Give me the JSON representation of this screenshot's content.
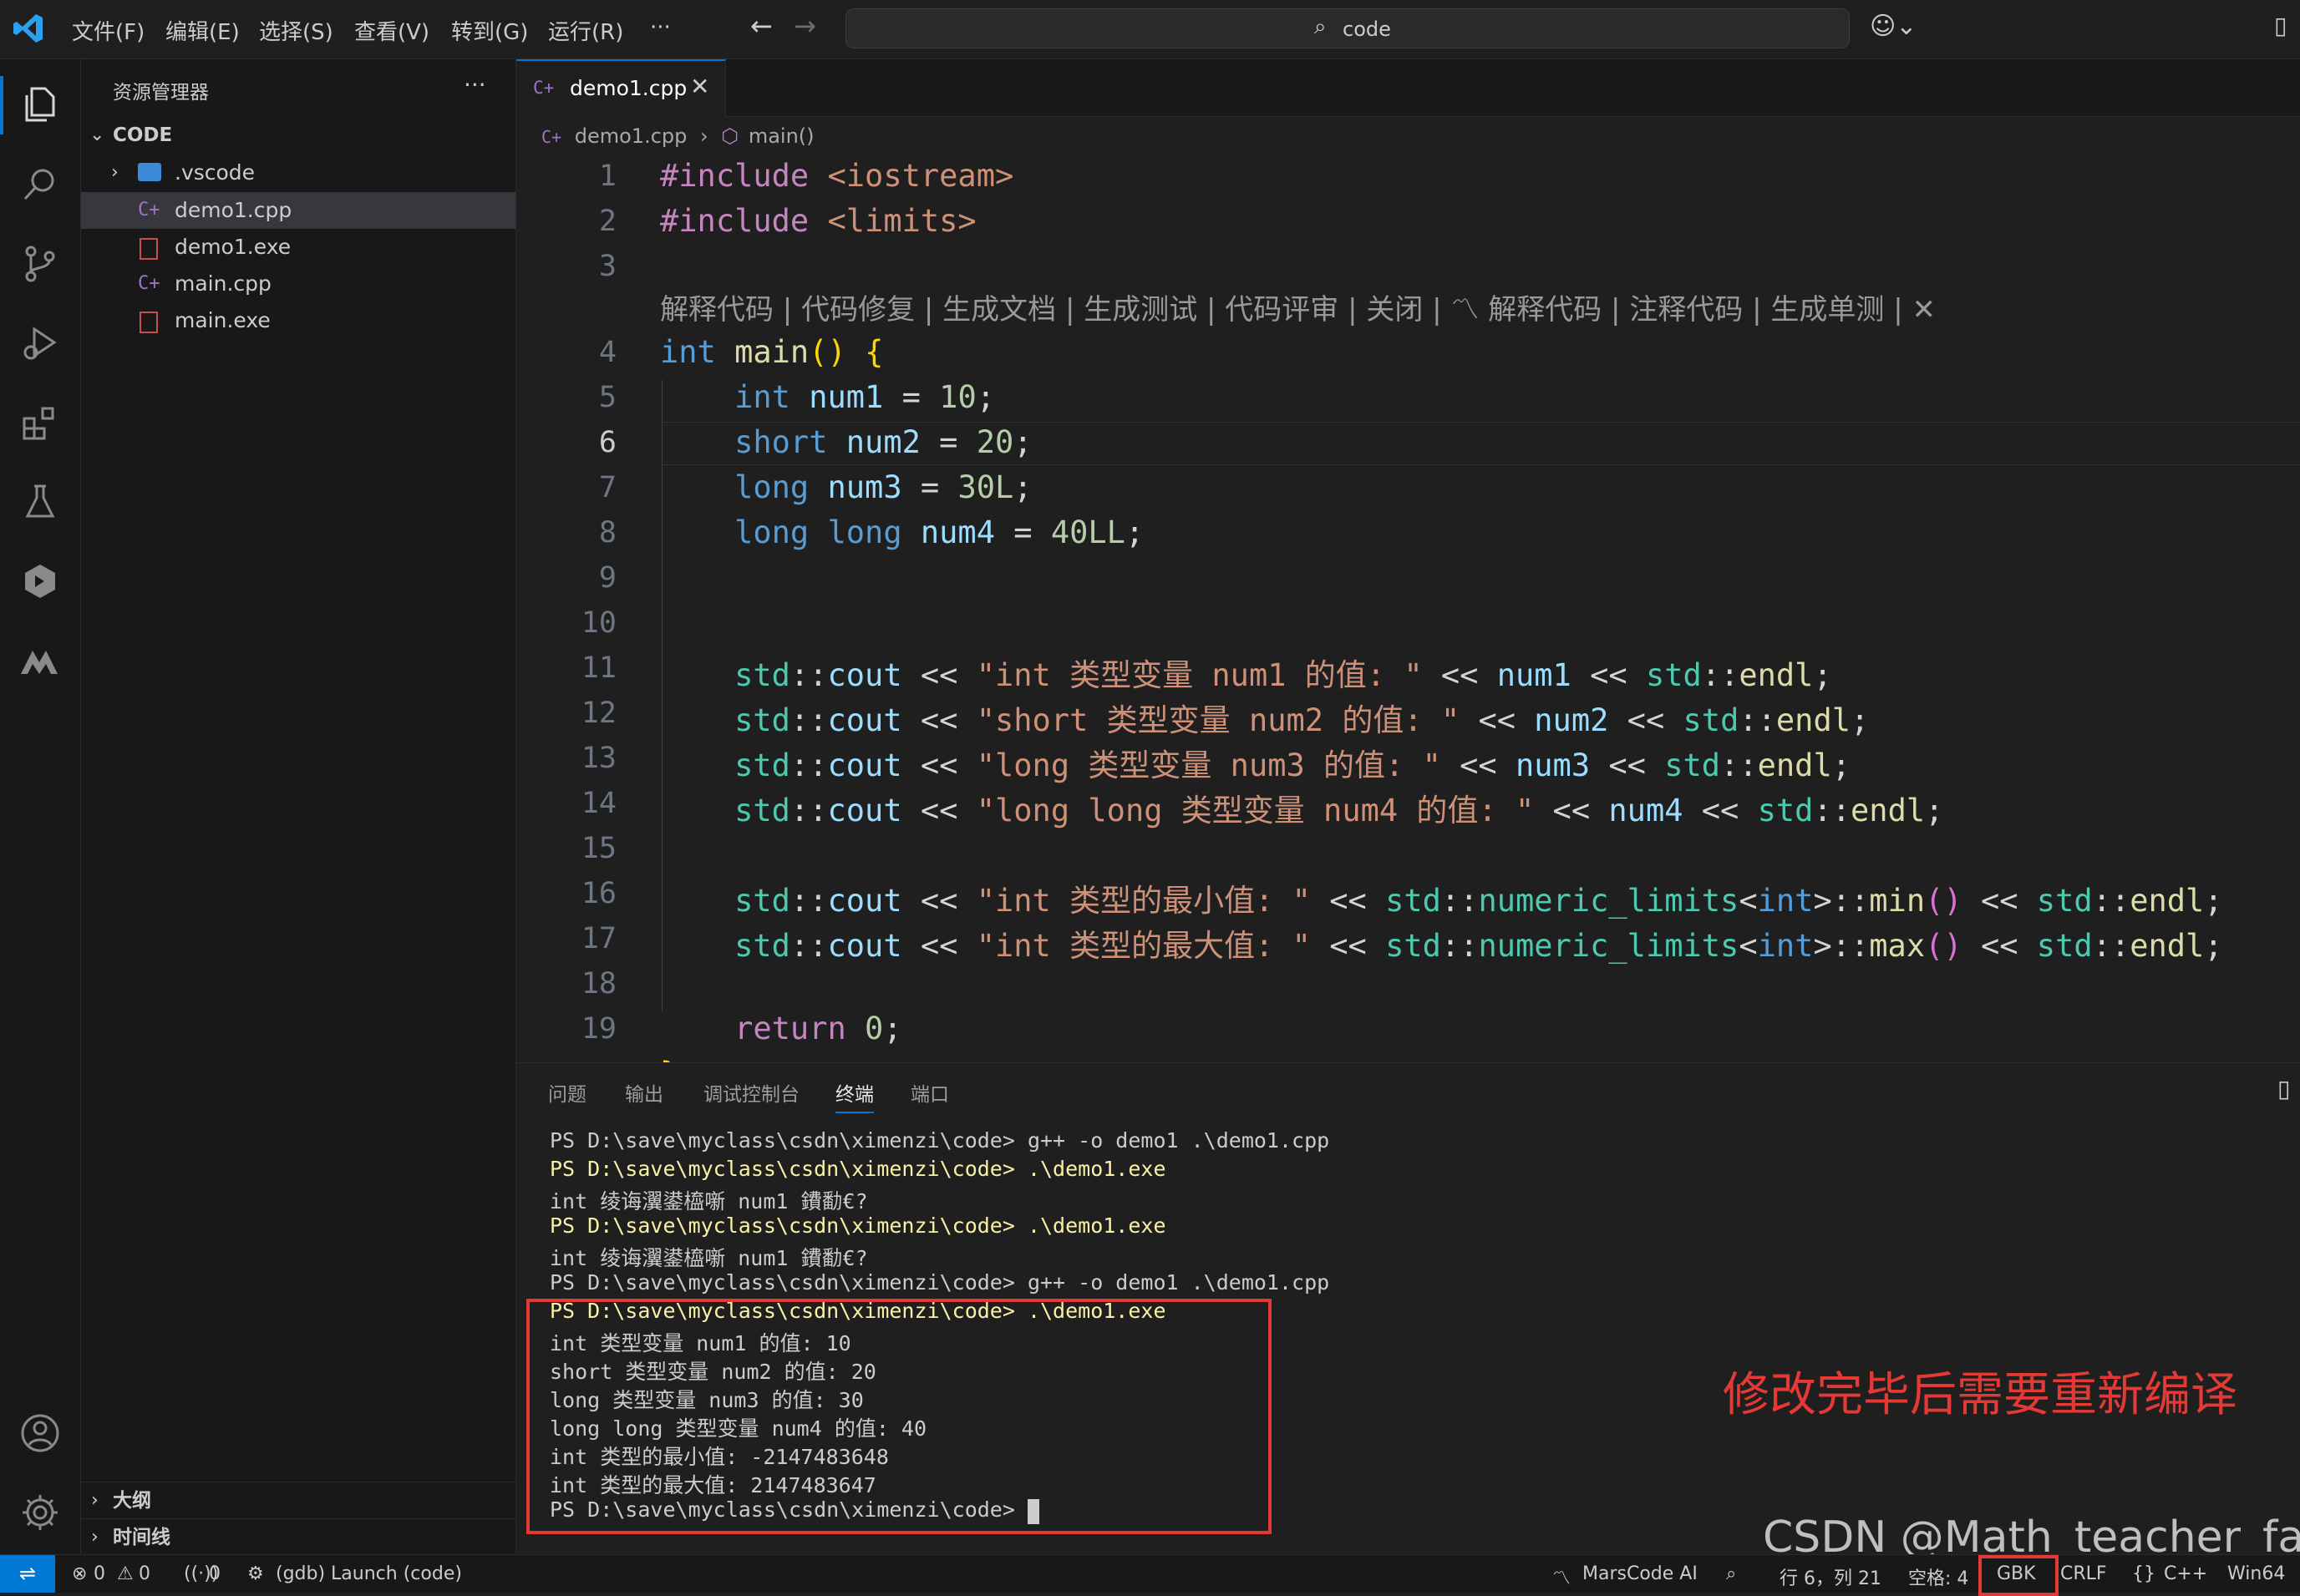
{
  "titlebar": {
    "menus": [
      "文件(F)",
      "编辑(E)",
      "选择(S)",
      "查看(V)",
      "转到(G)",
      "运行(R)",
      "···"
    ],
    "search": "code"
  },
  "sidebar": {
    "title": "资源管理器",
    "more": "···",
    "folder": "CODE",
    "files": [
      ".vscode",
      "demo1.cpp",
      "demo1.exe",
      "main.cpp",
      "main.exe"
    ],
    "outline": "大纲",
    "timeline": "时间线"
  },
  "editor": {
    "tab": "demo1.cpp",
    "breadcrumb_file": "demo1.cpp",
    "breadcrumb_symbol": "main()",
    "codelens_left": "解释代码 | 代码修复 | 生成文档 | 生成测试 | 代码评审 | 关闭 |",
    "codelens_right": "解释代码 | 注释代码 | 生成单测 |",
    "line_numbers": [
      "1",
      "2",
      "3",
      "4",
      "5",
      "6",
      "7",
      "8",
      "9",
      "10",
      "11",
      "12",
      "13",
      "14",
      "15",
      "16",
      "17",
      "18",
      "19"
    ]
  },
  "panel": {
    "tabs": [
      "问题",
      "输出",
      "调试控制台",
      "终端",
      "端口"
    ],
    "terminal_lines": [
      "PS D:\\save\\myclass\\csdn\\ximenzi\\code> g++ -o demo1 .\\demo1.cpp",
      "PS D:\\save\\myclass\\csdn\\ximenzi\\code> .\\demo1.exe",
      "int 绫诲瀷鍙橀噺 num1 鐨勫€?",
      "PS D:\\save\\myclass\\csdn\\ximenzi\\code> .\\demo1.exe",
      "int 绫诲瀷鍙橀噺 num1 鐨勫€?",
      "PS D:\\save\\myclass\\csdn\\ximenzi\\code> g++ -o demo1 .\\demo1.cpp",
      "PS D:\\save\\myclass\\csdn\\ximenzi\\code> .\\demo1.exe",
      "int 类型变量 num1 的值: 10",
      "short 类型变量 num2 的值: 20",
      "long 类型变量 num3 的值: 30",
      "long long 类型变量 num4 的值: 40",
      "int 类型的最小值: -2147483648",
      "int 类型的最大值: 2147483647",
      "PS D:\\save\\myclass\\csdn\\ximenzi\\code> "
    ],
    "annotation": "修改完毕后需要重新编译"
  },
  "statusbar": {
    "errors": "0",
    "warnings": "0",
    "ports": "0",
    "debug": "(gdb) Launch (code)",
    "marscode": "MarsCode AI",
    "position": "行 6，列 21",
    "spaces": "空格: 4",
    "encoding": "GBK",
    "eol": "CRLF",
    "language": "C++",
    "platform": "Win64"
  },
  "watermark": "CSDN @Math_teacher_fan",
  "colors": {
    "accent": "#0078d4",
    "annotation": "#e53935"
  }
}
